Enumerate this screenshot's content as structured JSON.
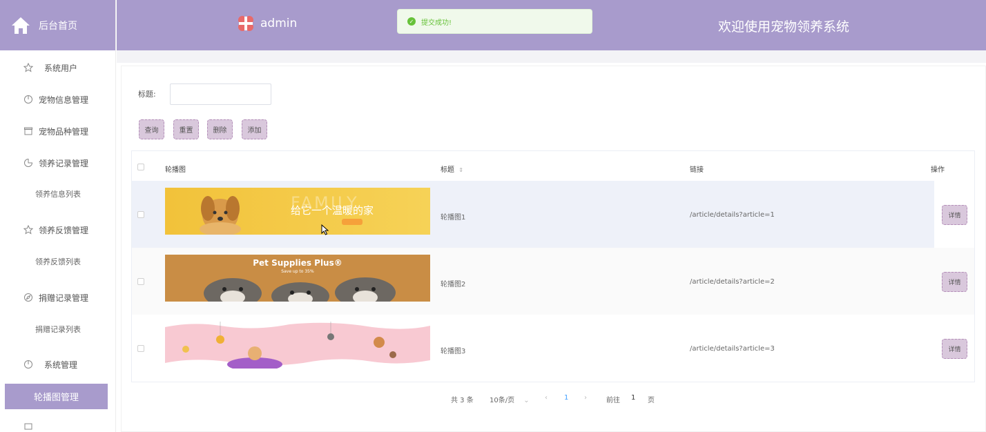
{
  "sidebar": {
    "home_label": "后台首页",
    "items": [
      {
        "label": "系统用户",
        "icon": "star-icon"
      },
      {
        "label": "宠物信息管理",
        "icon": "pie-icon"
      },
      {
        "label": "宠物品种管理",
        "icon": "box-icon"
      },
      {
        "label": "领养记录管理",
        "icon": "pie-icon"
      },
      {
        "label": "领养信息列表"
      },
      {
        "label": "领养反馈管理",
        "icon": "star-icon"
      },
      {
        "label": "领养反馈列表"
      },
      {
        "label": "捐赠记录管理",
        "icon": "compass-icon"
      },
      {
        "label": "捐赠记录列表"
      },
      {
        "label": "系统管理",
        "icon": "pie-icon"
      },
      {
        "label": "轮播图管理"
      }
    ]
  },
  "header": {
    "brand": "admin",
    "welcome": "欢迎使用宠物领养系统",
    "toast": "提交成功!"
  },
  "search": {
    "label": "标题:",
    "value": "",
    "placeholder": ""
  },
  "toolbar": {
    "query": "查询",
    "reset": "重置",
    "delete": "删除",
    "add": "添加"
  },
  "table": {
    "headers": {
      "image": "轮播图",
      "title": "标题",
      "link": "链接",
      "action": "操作"
    },
    "rows": [
      {
        "title": "轮播图1",
        "link": "/article/details?article=1",
        "action": "详情",
        "banner": {
          "family": "FAMILY",
          "slogan": "给它一个温暖的家"
        }
      },
      {
        "title": "轮播图2",
        "link": "/article/details?article=2",
        "action": "详情",
        "banner": {
          "headline": "Pet Supplies Plus®",
          "sub": "Save up to 35%"
        }
      },
      {
        "title": "轮播图3",
        "link": "/article/details?article=3",
        "action": "详情",
        "banner": {}
      }
    ]
  },
  "pager": {
    "total": "共 3 条",
    "size": "10条/页",
    "prev": "‹",
    "current": "1",
    "next": "›",
    "goto": "前往",
    "goto_value": "1",
    "page_suffix": "页"
  },
  "colors": {
    "accent": "#a89bcc",
    "button_bg": "#d9c8dc",
    "success": "#67c23a"
  }
}
